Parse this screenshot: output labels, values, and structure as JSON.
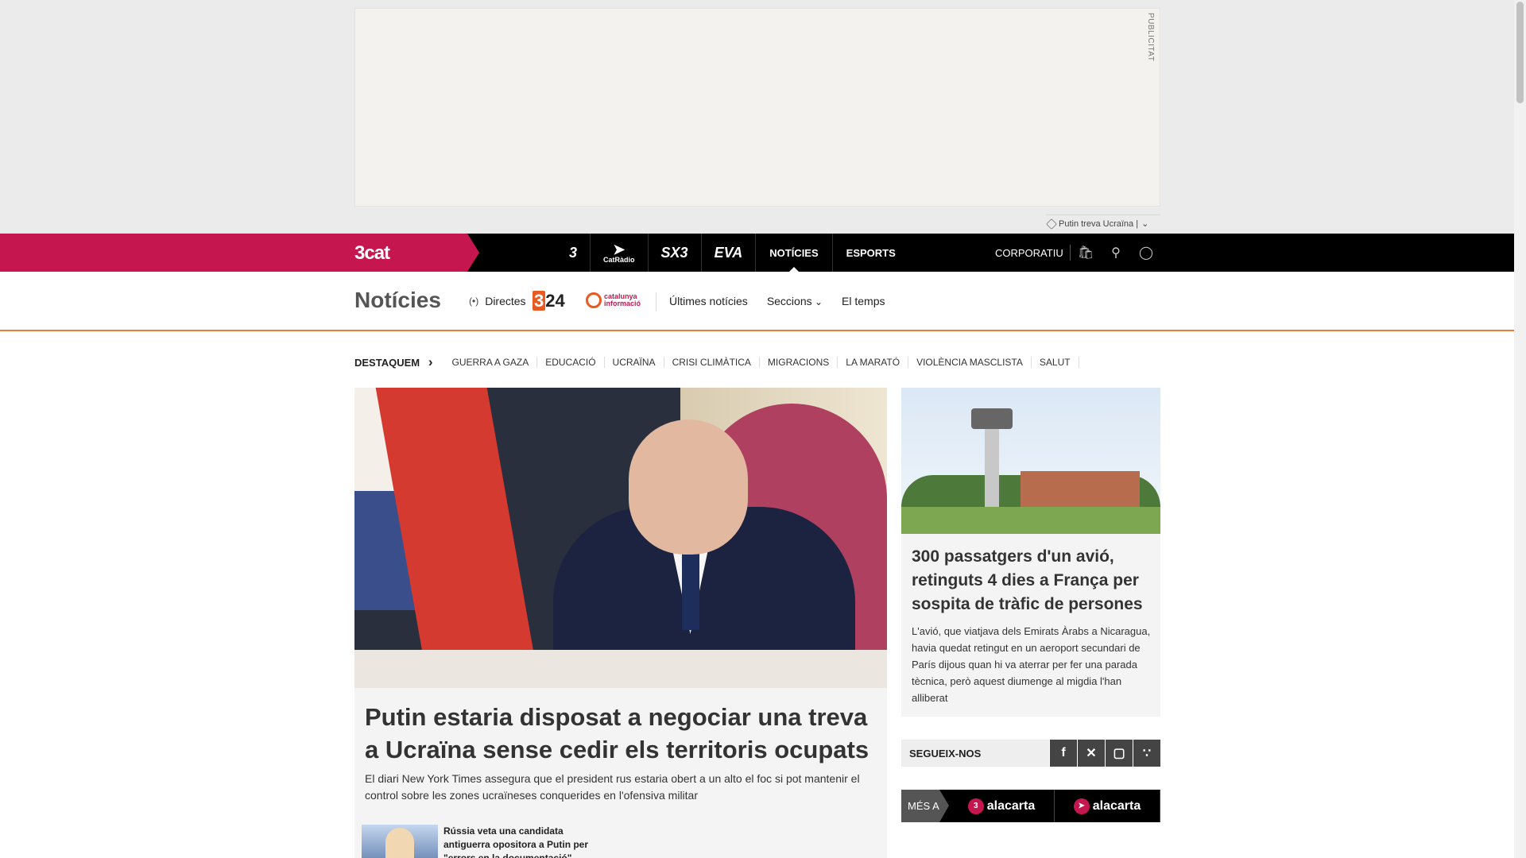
{
  "ad": {
    "label": "PUBLICITAT",
    "tag": "Putin treva Ucraïna |"
  },
  "topnav": {
    "brand": "3cat",
    "channels": [
      {
        "name": "tv3",
        "label": "3"
      },
      {
        "name": "catradio",
        "label": "CatRàdio"
      },
      {
        "name": "sx3",
        "label": "SX3"
      },
      {
        "name": "eva",
        "label": "EVA"
      }
    ],
    "links": [
      "NOTÍCIES",
      "ESPORTS"
    ],
    "corporatiu": "CORPORATIU"
  },
  "section": {
    "title": "Notícies",
    "directes": "Directes",
    "logo_324": "24",
    "logo_324_prefix": "3",
    "logo_catinfo": "catalunya informació",
    "nav": [
      "Últimes notícies",
      "Seccions",
      "El temps"
    ]
  },
  "destaquem": {
    "label": "DESTAQUEM",
    "items": [
      "GUERRA A GAZA",
      "EDUCACIÓ",
      "UCRAÏNA",
      "CRISI CLIMÀTICA",
      "MIGRACIONS",
      "LA MARATÓ",
      "VIOLÈNCIA MASCLISTA",
      "SALUT"
    ]
  },
  "main_story": {
    "title": "Putin estaria disposat a negociar una treva a Ucraïna sense cedir els territoris ocupats",
    "subtitle": "El diari New York Times assegura que el president rus estaria obert a un alto el foc si pot mantenir el control sobre les zones ucraïneses conquerides en l'ofensiva militar",
    "related": "Rússia veta una candidata antiguerra opositora a Putin per \"errors en la documentació\""
  },
  "side_story": {
    "title": "300 passatgers d'un avió, retinguts 4 dies a França per sospita de tràfic de persones",
    "subtitle": "L'avió, que viatjava dels Emirats Àrabs a Nicaragua, havia quedat retingut en un aeroport secundari de París dijous quan hi va aterrar per fer una parada tècnica, però aquest diumenge al migdia l'han alliberat"
  },
  "social": {
    "label": "SEGUEIX-NOS",
    "icons": [
      "facebook-icon",
      "x-icon",
      "instagram-icon",
      "rss-icon"
    ]
  },
  "alacarta": {
    "more": "MÉS A",
    "tv3": "alacarta",
    "tv3_badge": "3",
    "catradio": "alacarta"
  }
}
